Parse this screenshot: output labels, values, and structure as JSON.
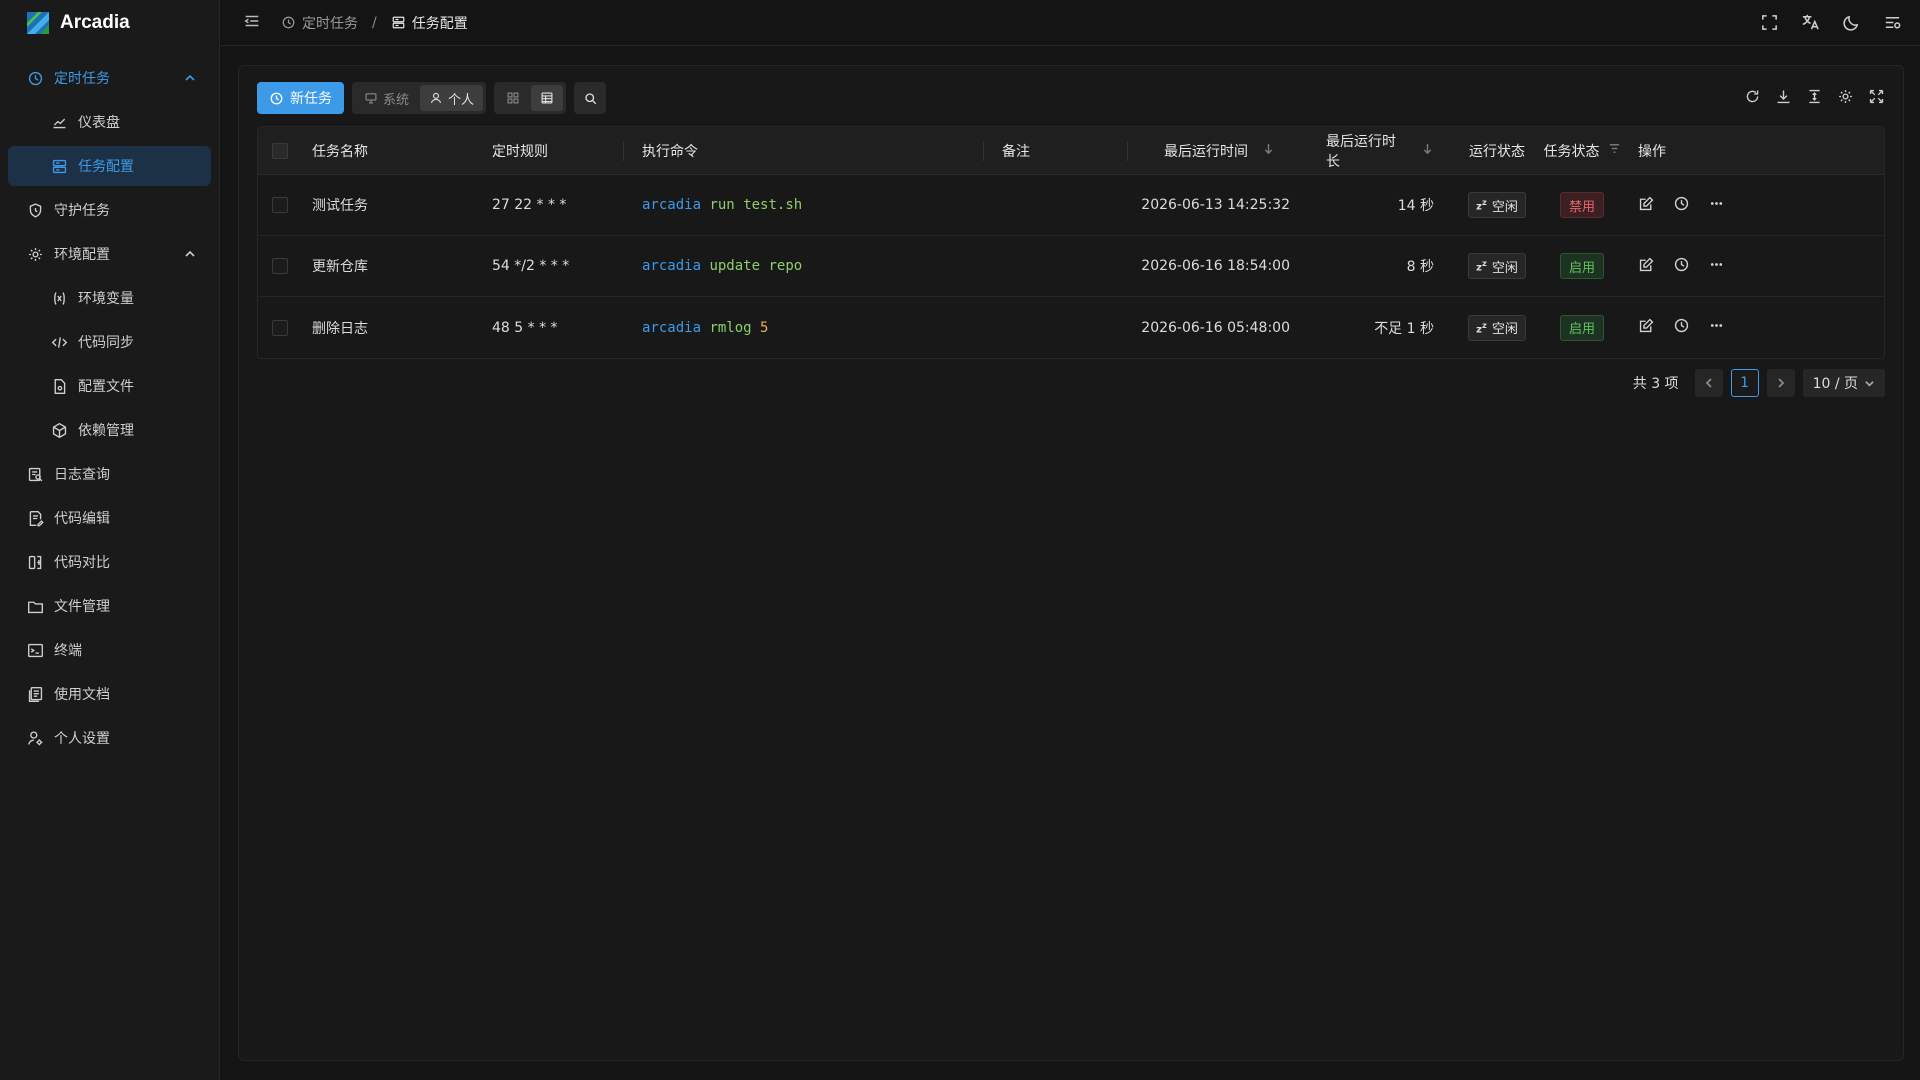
{
  "app": {
    "name": "Arcadia"
  },
  "sidebar": {
    "items": [
      {
        "label": "定时任务",
        "icon": "clock-icon",
        "group": true,
        "open": true
      },
      {
        "label": "仪表盘",
        "icon": "chart-line-icon",
        "sub": true
      },
      {
        "label": "任务配置",
        "icon": "list-config-icon",
        "sub": true,
        "active": true
      },
      {
        "label": "守护任务",
        "icon": "shield-clock-icon"
      },
      {
        "label": "环境配置",
        "icon": "gear-icon",
        "group": true,
        "open": true
      },
      {
        "label": "环境变量",
        "icon": "variable-icon",
        "sub": true
      },
      {
        "label": "代码同步",
        "icon": "code-sync-icon",
        "sub": true
      },
      {
        "label": "配置文件",
        "icon": "config-file-icon",
        "sub": true
      },
      {
        "label": "依赖管理",
        "icon": "package-icon",
        "sub": true
      },
      {
        "label": "日志查询",
        "icon": "log-search-icon"
      },
      {
        "label": "代码编辑",
        "icon": "code-edit-icon"
      },
      {
        "label": "代码对比",
        "icon": "diff-icon"
      },
      {
        "label": "文件管理",
        "icon": "folder-icon"
      },
      {
        "label": "终端",
        "icon": "terminal-icon"
      },
      {
        "label": "使用文档",
        "icon": "docs-icon"
      },
      {
        "label": "个人设置",
        "icon": "user-settings-icon"
      }
    ]
  },
  "breadcrumb": {
    "parent": "定时任务",
    "current": "任务配置"
  },
  "toolbar": {
    "new_task": "新任务",
    "filter_system": "系统",
    "filter_personal": "个人"
  },
  "table": {
    "headers": {
      "name": "任务名称",
      "rule": "定时规则",
      "command": "执行命令",
      "note": "备注",
      "last_run": "最后运行时间",
      "last_duration": "最后运行时长",
      "run_state": "运行状态",
      "task_state": "任务状态",
      "ops": "操作"
    },
    "rows": [
      {
        "name": "测试任务",
        "rule": "27 22 * * *",
        "cmd_bin": "arcadia",
        "cmd_sub": "run",
        "cmd_arg": "test.sh",
        "cmd_arg_type": "arg",
        "note": "",
        "last_run": "2026-06-13 14:25:32",
        "duration": "14 秒",
        "run_state": "空闲",
        "task_state": "禁用",
        "enabled": false
      },
      {
        "name": "更新仓库",
        "rule": "54 */2 * * *",
        "cmd_bin": "arcadia",
        "cmd_sub": "update",
        "cmd_arg": "repo",
        "cmd_arg_type": "arg",
        "note": "",
        "last_run": "2026-06-16 18:54:00",
        "duration": "8 秒",
        "run_state": "空闲",
        "task_state": "启用",
        "enabled": true
      },
      {
        "name": "删除日志",
        "rule": "48 5 * * *",
        "cmd_bin": "arcadia",
        "cmd_sub": "rmlog",
        "cmd_arg": "5",
        "cmd_arg_type": "num",
        "note": "",
        "last_run": "2026-06-16 05:48:00",
        "duration": "不足 1 秒",
        "run_state": "空闲",
        "task_state": "启用",
        "enabled": true
      }
    ]
  },
  "pager": {
    "total": "共 3 项",
    "current": "1",
    "page_size": "10 / 页"
  },
  "colors": {
    "accent": "#3c9ae8",
    "enabled": "#63c45f",
    "disabled": "#e8656b",
    "background": "#141414"
  }
}
